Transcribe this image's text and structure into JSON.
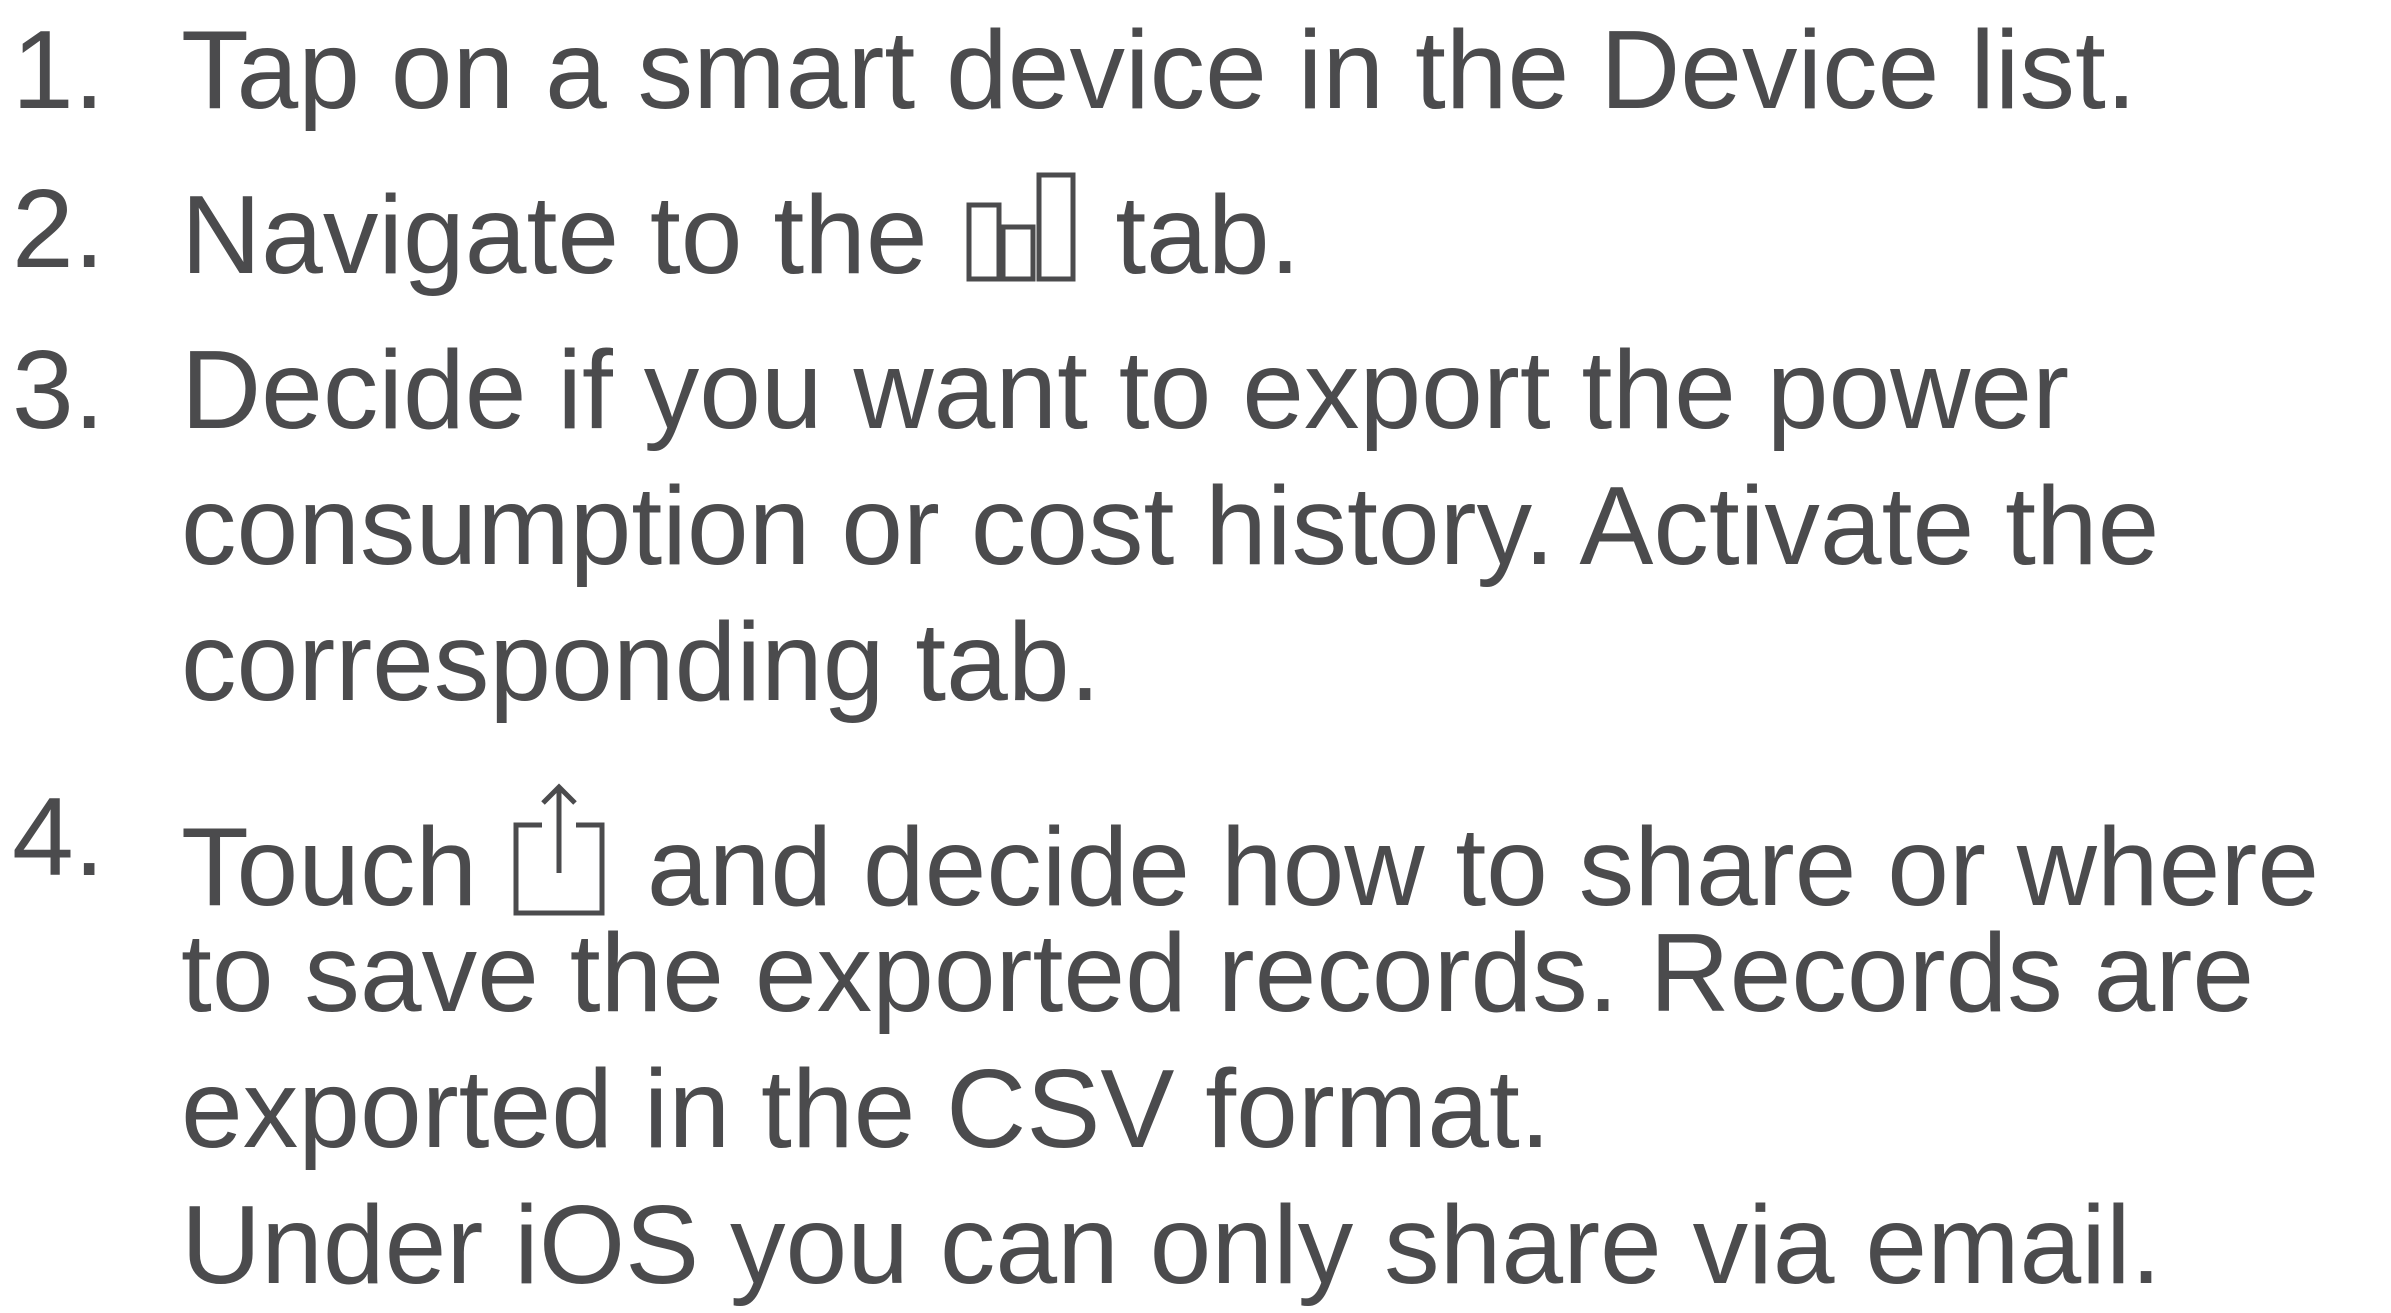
{
  "steps": [
    {
      "number": "1.",
      "lines": [
        "Tap on a smart device in the Device list."
      ]
    },
    {
      "number": "2.",
      "before_icon": "Navigate to the",
      "icon": "bar-chart-icon",
      "after_icon": "tab."
    },
    {
      "number": "3.",
      "lines": [
        "Decide if you want to export the power",
        "consumption or cost history. Activate the",
        "corresponding tab."
      ]
    },
    {
      "number": "4.",
      "before_icon": "Touch",
      "icon": "share-icon",
      "after_icon": "and decide how to share or where",
      "lines": [
        "to save the exported records. Records are",
        "exported in the CSV format.",
        "Under iOS you can only share via email."
      ]
    }
  ],
  "colors": {
    "text": "#4b4b4d",
    "background": "#ffffff"
  }
}
